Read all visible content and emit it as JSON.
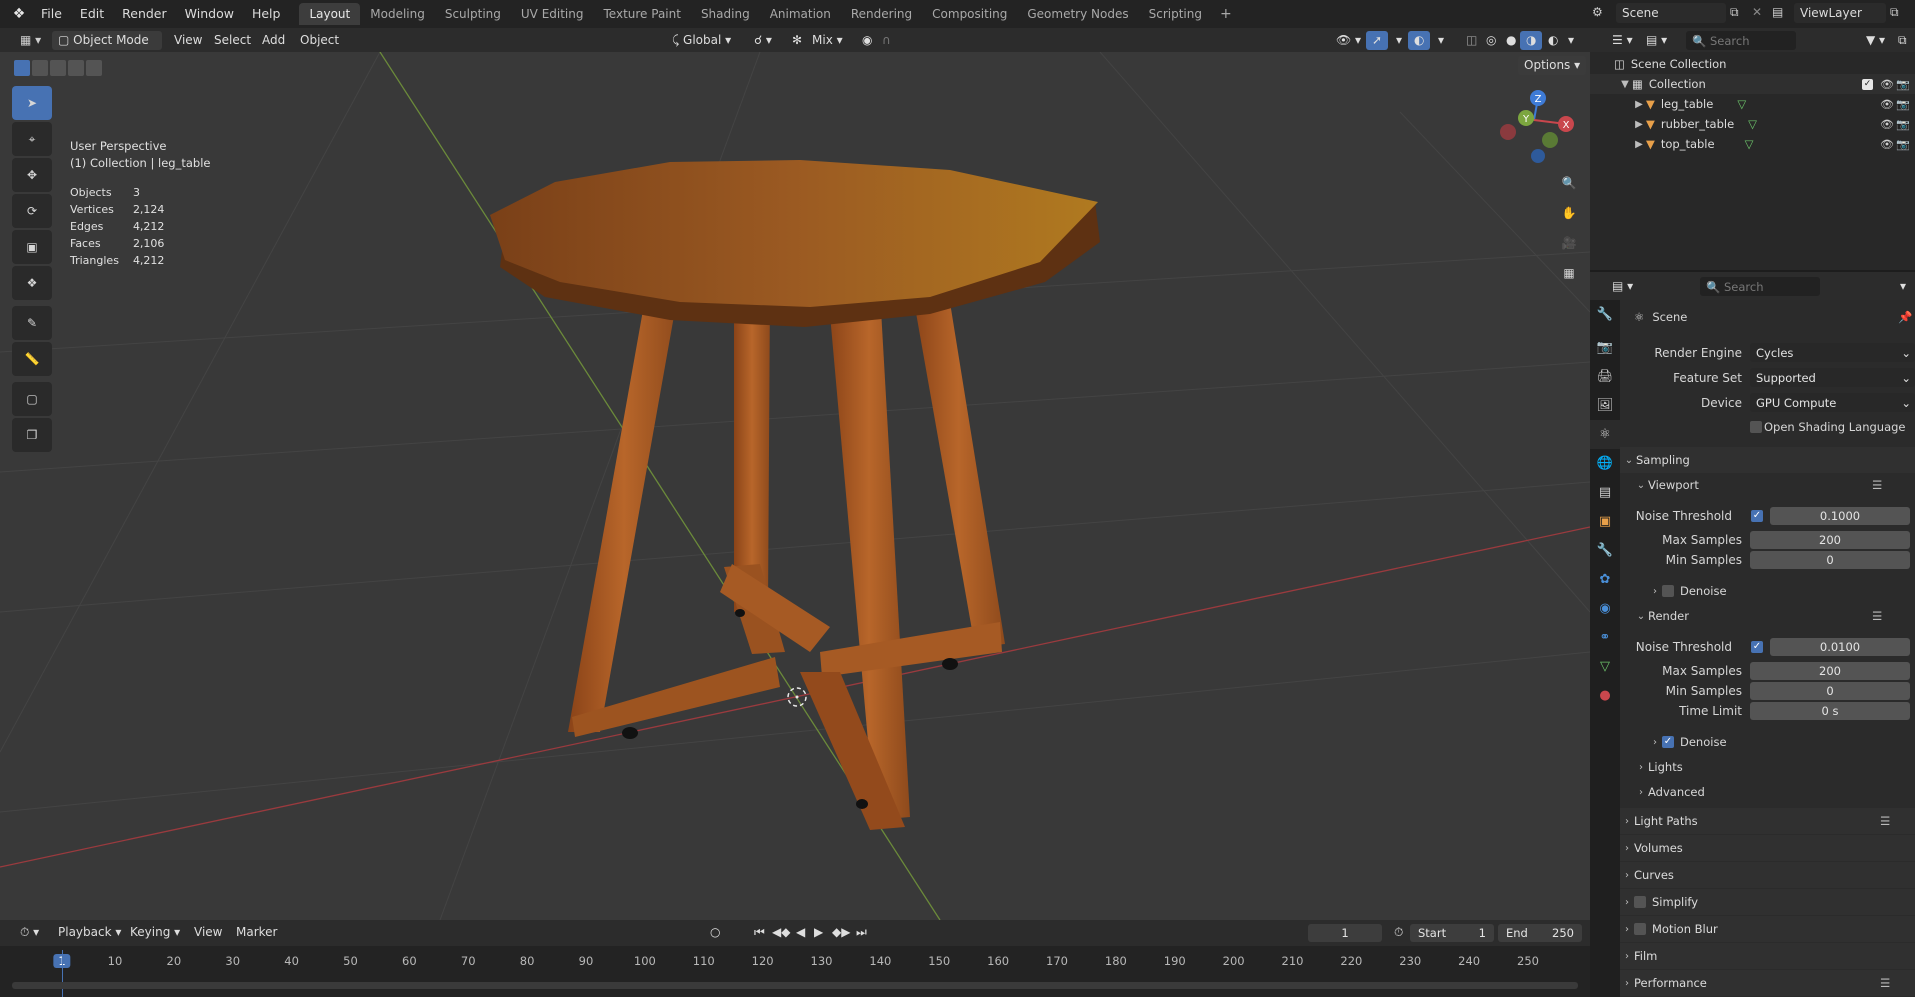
{
  "topbar": {
    "menus": [
      "File",
      "Edit",
      "Render",
      "Window",
      "Help"
    ],
    "workspaces": [
      "Layout",
      "Modeling",
      "Sculpting",
      "UV Editing",
      "Texture Paint",
      "Shading",
      "Animation",
      "Rendering",
      "Compositing",
      "Geometry Nodes",
      "Scripting"
    ],
    "active_workspace": "Layout",
    "scene": "Scene",
    "view_layer": "ViewLayer"
  },
  "viewport_header": {
    "mode": "Object Mode",
    "menus": [
      "View",
      "Select",
      "Add",
      "Object"
    ],
    "orientation": "Global",
    "snap_mix": "Mix",
    "options": "Options"
  },
  "viewport": {
    "view_name": "User Perspective",
    "collection_info": "(1) Collection | leg_table",
    "stats": [
      {
        "label": "Objects",
        "value": "3"
      },
      {
        "label": "Vertices",
        "value": "2,124"
      },
      {
        "label": "Edges",
        "value": "4,212"
      },
      {
        "label": "Faces",
        "value": "2,106"
      },
      {
        "label": "Triangles",
        "value": "4,212"
      }
    ],
    "gizmo_axes": {
      "x": "X",
      "y": "Y",
      "z": "Z"
    },
    "colors": {
      "x_axis": "#c9474d",
      "y_axis": "#7ca63f",
      "z_axis": "#3e7bd6",
      "wood": "#a85a22",
      "accent": "#4772b3"
    }
  },
  "timeline": {
    "menus": [
      "Playback",
      "Keying",
      "View",
      "Marker"
    ],
    "current_frame": "1",
    "start_label": "Start",
    "start": "1",
    "end_label": "End",
    "end": "250",
    "ruler": [
      "1",
      "10",
      "20",
      "30",
      "40",
      "50",
      "60",
      "70",
      "80",
      "90",
      "100",
      "110",
      "120",
      "130",
      "140",
      "150",
      "160",
      "170",
      "180",
      "190",
      "200",
      "210",
      "220",
      "230",
      "240",
      "250"
    ]
  },
  "outliner": {
    "search_placeholder": "Search",
    "root": "Scene Collection",
    "collection": "Collection",
    "items": [
      "leg_table",
      "rubber_table",
      "top_table"
    ]
  },
  "properties": {
    "search_placeholder": "Search",
    "context": "Scene",
    "render_engine_label": "Render Engine",
    "render_engine": "Cycles",
    "feature_set_label": "Feature Set",
    "feature_set": "Supported",
    "device_label": "Device",
    "device": "GPU Compute",
    "osl_label": "Open Shading Language",
    "sampling": "Sampling",
    "viewport": {
      "title": "Viewport",
      "noise_threshold_label": "Noise Threshold",
      "noise_threshold": "0.1000",
      "max_samples_label": "Max Samples",
      "max_samples": "200",
      "min_samples_label": "Min Samples",
      "min_samples": "0",
      "denoise_label": "Denoise"
    },
    "render": {
      "title": "Render",
      "noise_threshold_label": "Noise Threshold",
      "noise_threshold": "0.0100",
      "max_samples_label": "Max Samples",
      "max_samples": "200",
      "min_samples_label": "Min Samples",
      "min_samples": "0",
      "time_limit_label": "Time Limit",
      "time_limit": "0 s",
      "denoise_label": "Denoise"
    },
    "lights": "Lights",
    "advanced": "Advanced",
    "panels": [
      "Light Paths",
      "Volumes",
      "Curves",
      "Simplify",
      "Motion Blur",
      "Film",
      "Performance"
    ]
  }
}
